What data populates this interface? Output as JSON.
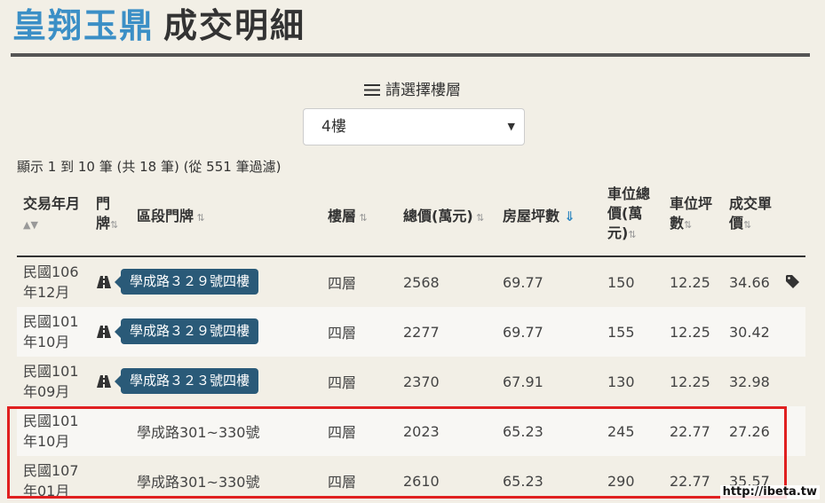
{
  "title": {
    "brand": "皇翔玉鼎",
    "rest": "成交明細"
  },
  "floor_filter": {
    "label": "請選擇樓層",
    "selected": "4樓"
  },
  "info": "顯示 1 到 10 筆 (共 18 筆) (從 551 筆過濾)",
  "columns": {
    "date": [
      "交易年月"
    ],
    "door": [
      "門",
      "牌"
    ],
    "address": [
      "區段門牌"
    ],
    "floor": [
      "樓層"
    ],
    "total": [
      "總價(萬元)"
    ],
    "area": [
      "房屋坪數"
    ],
    "car_price": [
      "車位總",
      "價(萬",
      "元)"
    ],
    "car_area": [
      "車位坪",
      "數"
    ],
    "unit_price": [
      "成交單",
      "價"
    ]
  },
  "rows": [
    {
      "date": [
        "民國106",
        "年12月"
      ],
      "address": "學成路３２９號四樓",
      "address_tag": true,
      "floor": "四層",
      "total": "2568",
      "area": "69.77",
      "car_price": "150",
      "car_area": "12.25",
      "unit_price": "34.66",
      "has_tag": true
    },
    {
      "date": [
        "民國101",
        "年10月"
      ],
      "address": "學成路３２９號四樓",
      "address_tag": true,
      "floor": "四層",
      "total": "2277",
      "area": "69.77",
      "car_price": "155",
      "car_area": "12.25",
      "unit_price": "30.42"
    },
    {
      "date": [
        "民國101",
        "年09月"
      ],
      "address": "學成路３２３號四樓",
      "address_tag": true,
      "floor": "四層",
      "total": "2370",
      "area": "67.91",
      "car_price": "130",
      "car_area": "12.25",
      "unit_price": "32.98"
    },
    {
      "date": [
        "民國101",
        "年10月"
      ],
      "address": "學成路301~330號",
      "address_tag": false,
      "floor": "四層",
      "total": "2023",
      "area": "65.23",
      "car_price": "245",
      "car_area": "22.77",
      "unit_price": "27.26"
    },
    {
      "date": [
        "民國107",
        "年01月"
      ],
      "address": "學成路301~330號",
      "address_tag": false,
      "floor": "四層",
      "total": "2610",
      "area": "65.23",
      "car_price": "290",
      "car_area": "22.77",
      "unit_price": "35.57"
    }
  ],
  "icons": {
    "menu": "menu-icon",
    "map": "map-icon",
    "tag": "tag-icon",
    "sort": "sort-icon",
    "caret": "caret-down-icon"
  },
  "accent_color": "#3b8fc6",
  "highlight_color": "#e02020",
  "watermark": "http://ibeta.tw"
}
